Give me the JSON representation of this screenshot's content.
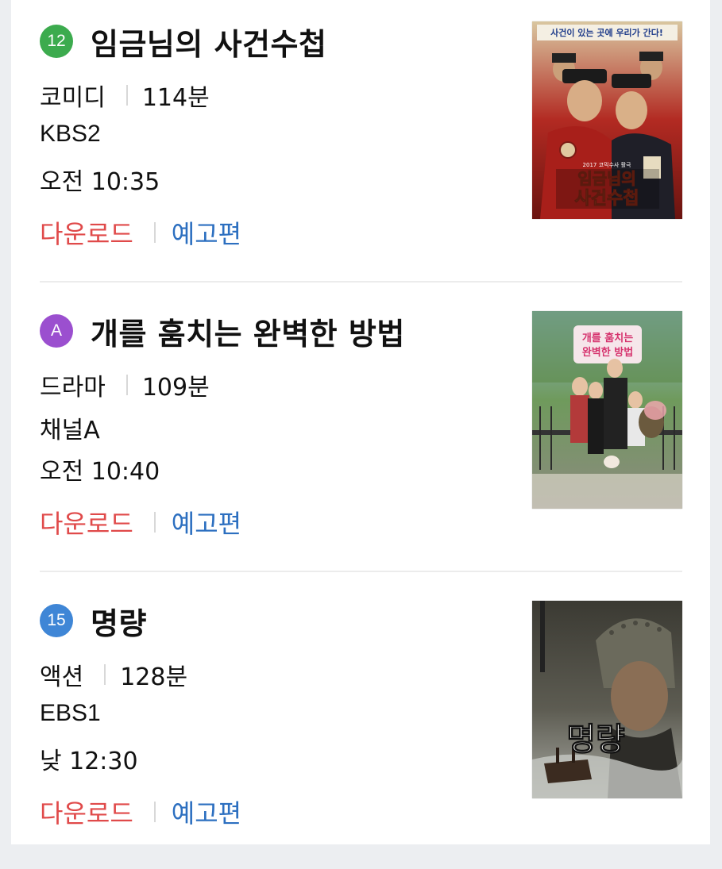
{
  "items": [
    {
      "rating": "12",
      "rating_color": "#3cab4e",
      "title": "임금님의 사건수첩",
      "genre": "코미디",
      "duration": "114분",
      "channel": "KBS2",
      "time": "오전 10:35",
      "download_label": "다운로드",
      "trailer_label": "예고편",
      "poster": {
        "tagline": "사건이 있는 곳에 우리가 간다!",
        "title_line1": "임금님의",
        "title_line2": "사건수첩",
        "year_note": "2017 코믹수사 활극"
      }
    },
    {
      "rating": "A",
      "rating_color": "#9b4fcf",
      "title": "개를 훔치는 완벽한 방법",
      "genre": "드라마",
      "duration": "109분",
      "channel": "채널A",
      "time": "오전 10:40",
      "download_label": "다운로드",
      "trailer_label": "예고편",
      "poster": {
        "title_line1": "개를 훔치는",
        "title_line2": "완벽한 방법"
      }
    },
    {
      "rating": "15",
      "rating_color": "#3f86d6",
      "title": "명량",
      "genre": "액션",
      "duration": "128분",
      "channel": "EBS1",
      "time": "낮 12:30",
      "download_label": "다운로드",
      "trailer_label": "예고편",
      "poster": {
        "title_line1": "명량"
      }
    }
  ],
  "colors": {
    "download": "#e04a4a",
    "trailer": "#2c6fc0",
    "divider": "#ececec"
  }
}
